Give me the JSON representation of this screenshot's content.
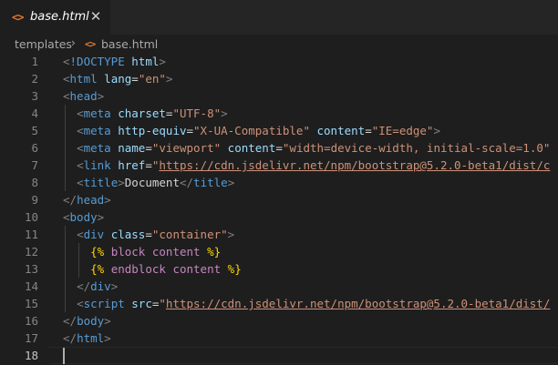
{
  "tab": {
    "icon": "<>",
    "label": "base.html",
    "close": "✕"
  },
  "breadcrumb": {
    "folder": "templates",
    "separator": "›",
    "file_icon": "<>",
    "file": "base.html"
  },
  "colors": {
    "tag": "#569cd6",
    "attribute": "#9cdcfe",
    "string": "#ce9178",
    "template_bracket": "#ffd700",
    "template_keyword": "#c586c0",
    "icon_accent": "#e37933"
  },
  "lines": [
    {
      "num": "1",
      "tokens": [
        [
          "punct",
          "<"
        ],
        [
          "tag",
          "!DOCTYPE"
        ],
        [
          "text",
          " "
        ],
        [
          "attr",
          "html"
        ],
        [
          "punct",
          ">"
        ]
      ]
    },
    {
      "num": "2",
      "tokens": [
        [
          "punct",
          "<"
        ],
        [
          "tag",
          "html"
        ],
        [
          "text",
          " "
        ],
        [
          "attr",
          "lang"
        ],
        [
          "text",
          "="
        ],
        [
          "str",
          "\"en\""
        ],
        [
          "punct",
          ">"
        ]
      ]
    },
    {
      "num": "3",
      "tokens": [
        [
          "punct",
          "<"
        ],
        [
          "tag",
          "head"
        ],
        [
          "punct",
          ">"
        ]
      ]
    },
    {
      "num": "4",
      "tokens": [
        [
          "text",
          "  "
        ],
        [
          "punct",
          "<"
        ],
        [
          "tag",
          "meta"
        ],
        [
          "text",
          " "
        ],
        [
          "attr",
          "charset"
        ],
        [
          "text",
          "="
        ],
        [
          "str",
          "\"UTF-8\""
        ],
        [
          "punct",
          ">"
        ]
      ]
    },
    {
      "num": "5",
      "tokens": [
        [
          "text",
          "  "
        ],
        [
          "punct",
          "<"
        ],
        [
          "tag",
          "meta"
        ],
        [
          "text",
          " "
        ],
        [
          "attr",
          "http-equiv"
        ],
        [
          "text",
          "="
        ],
        [
          "str",
          "\"X-UA-Compatible\""
        ],
        [
          "text",
          " "
        ],
        [
          "attr",
          "content"
        ],
        [
          "text",
          "="
        ],
        [
          "str",
          "\"IE=edge\""
        ],
        [
          "punct",
          ">"
        ]
      ]
    },
    {
      "num": "6",
      "tokens": [
        [
          "text",
          "  "
        ],
        [
          "punct",
          "<"
        ],
        [
          "tag",
          "meta"
        ],
        [
          "text",
          " "
        ],
        [
          "attr",
          "name"
        ],
        [
          "text",
          "="
        ],
        [
          "str",
          "\"viewport\""
        ],
        [
          "text",
          " "
        ],
        [
          "attr",
          "content"
        ],
        [
          "text",
          "="
        ],
        [
          "str",
          "\"width=device-width, initial-scale=1.0\""
        ]
      ]
    },
    {
      "num": "7",
      "tokens": [
        [
          "text",
          "  "
        ],
        [
          "punct",
          "<"
        ],
        [
          "tag",
          "link"
        ],
        [
          "text",
          " "
        ],
        [
          "attr",
          "href"
        ],
        [
          "text",
          "="
        ],
        [
          "str",
          "\""
        ],
        [
          "link",
          "https://cdn.jsdelivr.net/npm/bootstrap@5.2.0-beta1/dist/c"
        ]
      ]
    },
    {
      "num": "8",
      "tokens": [
        [
          "text",
          "  "
        ],
        [
          "punct",
          "<"
        ],
        [
          "tag",
          "title"
        ],
        [
          "punct",
          ">"
        ],
        [
          "text",
          "Document"
        ],
        [
          "punct",
          "</"
        ],
        [
          "tag",
          "title"
        ],
        [
          "punct",
          ">"
        ]
      ]
    },
    {
      "num": "9",
      "tokens": [
        [
          "punct",
          "</"
        ],
        [
          "tag",
          "head"
        ],
        [
          "punct",
          ">"
        ]
      ]
    },
    {
      "num": "10",
      "tokens": [
        [
          "punct",
          "<"
        ],
        [
          "tag",
          "body"
        ],
        [
          "punct",
          ">"
        ]
      ]
    },
    {
      "num": "11",
      "tokens": [
        [
          "text",
          "  "
        ],
        [
          "punct",
          "<"
        ],
        [
          "tag",
          "div"
        ],
        [
          "text",
          " "
        ],
        [
          "attr",
          "class"
        ],
        [
          "text",
          "="
        ],
        [
          "str",
          "\"container\""
        ],
        [
          "punct",
          ">"
        ]
      ]
    },
    {
      "num": "12",
      "tokens": [
        [
          "text",
          "    "
        ],
        [
          "tmpl",
          "{%"
        ],
        [
          "text",
          " "
        ],
        [
          "kw",
          "block"
        ],
        [
          "text",
          " "
        ],
        [
          "kw",
          "content"
        ],
        [
          "text",
          " "
        ],
        [
          "tmpl",
          "%}"
        ]
      ]
    },
    {
      "num": "13",
      "tokens": [
        [
          "text",
          "    "
        ],
        [
          "tmpl",
          "{%"
        ],
        [
          "text",
          " "
        ],
        [
          "kw",
          "endblock"
        ],
        [
          "text",
          " "
        ],
        [
          "kw",
          "content"
        ],
        [
          "text",
          " "
        ],
        [
          "tmpl",
          "%}"
        ]
      ]
    },
    {
      "num": "14",
      "tokens": [
        [
          "text",
          "  "
        ],
        [
          "punct",
          "</"
        ],
        [
          "tag",
          "div"
        ],
        [
          "punct",
          ">"
        ]
      ]
    },
    {
      "num": "15",
      "tokens": [
        [
          "text",
          "  "
        ],
        [
          "punct",
          "<"
        ],
        [
          "tag",
          "script"
        ],
        [
          "text",
          " "
        ],
        [
          "attr",
          "src"
        ],
        [
          "text",
          "="
        ],
        [
          "str",
          "\""
        ],
        [
          "link",
          "https://cdn.jsdelivr.net/npm/bootstrap@5.2.0-beta1/dist/"
        ]
      ]
    },
    {
      "num": "16",
      "tokens": [
        [
          "punct",
          "</"
        ],
        [
          "tag",
          "body"
        ],
        [
          "punct",
          ">"
        ]
      ]
    },
    {
      "num": "17",
      "tokens": [
        [
          "punct",
          "</"
        ],
        [
          "tag",
          "html"
        ],
        [
          "punct",
          ">"
        ]
      ]
    },
    {
      "num": "18",
      "tokens": []
    }
  ],
  "active_line": "18"
}
